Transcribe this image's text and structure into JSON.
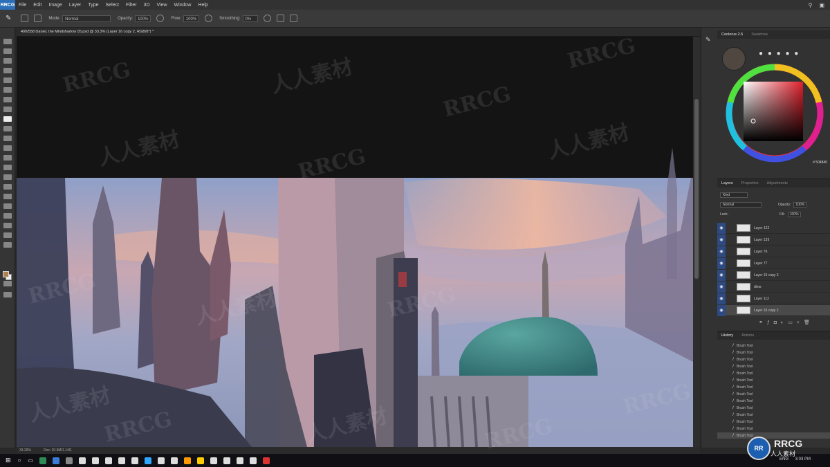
{
  "app": {
    "logo": "RRCG",
    "menu": [
      "File",
      "Edit",
      "Image",
      "Layer",
      "Type",
      "Select",
      "Filter",
      "3D",
      "View",
      "Window",
      "Help"
    ]
  },
  "options": {
    "mode_label": "Mode:",
    "mode_value": "Normal",
    "opacity_label": "Opacity:",
    "opacity_value": "100%",
    "flow_label": "Flow:",
    "flow_value": "100%",
    "smoothing_label": "Smoothing:",
    "smoothing_value": "0%"
  },
  "document": {
    "tab_title": "400/558 Daniel, the Mindshadow 05.psd @ 33.3% (Layer 16 copy 2, RGB/8*) *"
  },
  "status": {
    "zoom": "33.29%",
    "doc_size": "Doc: 20.9M/1.14G"
  },
  "color_panel": {
    "tabs": [
      "Coolorus 2.5",
      "Swatches"
    ],
    "hex": "# 504840"
  },
  "layers_panel": {
    "tabs": [
      "Layers",
      "Properties",
      "Adjustments"
    ],
    "kind_label": "Kind",
    "blend_mode": "Normal",
    "opacity_label": "Opacity:",
    "opacity_value": "100%",
    "lock_label": "Lock:",
    "fill_label": "Fill:",
    "fill_value": "100%",
    "layers": [
      "Layer 122",
      "Layer 129",
      "Layer 76",
      "Layer 77",
      "Layer 16 copy 3",
      "dims",
      "Layer 112",
      "Layer 16 copy 2"
    ]
  },
  "history_panel": {
    "tabs": [
      "History",
      "Actions"
    ],
    "items": [
      "Brush Tool",
      "Brush Tool",
      "Brush Tool",
      "Brush Tool",
      "Brush Tool",
      "Brush Tool",
      "Brush Tool",
      "Brush Tool",
      "Brush Tool",
      "Brush Tool",
      "Brush Tool",
      "Brush Tool",
      "Brush Tool",
      "Brush Tool"
    ]
  },
  "taskbar": {
    "lang": "ENG",
    "time": "3:03 PM"
  },
  "watermarks": {
    "rrcg": "RRCG",
    "cn": "人人素材"
  },
  "brand": {
    "circle": "RR",
    "name": "RRCG",
    "sub": "人人素材"
  }
}
